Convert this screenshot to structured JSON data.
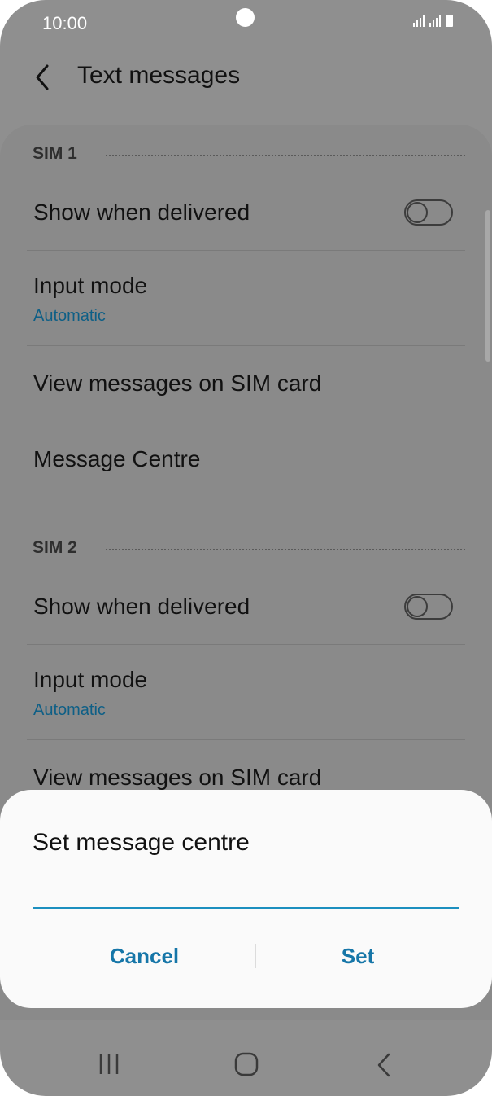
{
  "status_bar": {
    "time": "10:00"
  },
  "header": {
    "title": "Text messages"
  },
  "sim1": {
    "label": "SIM 1",
    "show_when_delivered": {
      "label": "Show when delivered",
      "enabled": false
    },
    "input_mode": {
      "label": "Input mode",
      "value": "Automatic"
    },
    "view_messages": {
      "label": "View messages on SIM card"
    },
    "message_centre": {
      "label": "Message Centre"
    }
  },
  "sim2": {
    "label": "SIM 2",
    "show_when_delivered": {
      "label": "Show when delivered",
      "enabled": false
    },
    "input_mode": {
      "label": "Input mode",
      "value": "Automatic"
    },
    "view_messages": {
      "label": "View messages on SIM card"
    }
  },
  "dialog": {
    "title": "Set message centre",
    "input_value": "",
    "cancel_label": "Cancel",
    "set_label": "Set"
  },
  "colors": {
    "accent": "#1676a8",
    "subtext": "#0e5f86",
    "scrim": "#8f8f8f",
    "dialog_bg": "#fafafa"
  },
  "icons": {
    "back": "chevron-left-icon",
    "nav_recent": "recent-apps-icon",
    "nav_home": "home-icon",
    "nav_back": "back-icon"
  }
}
